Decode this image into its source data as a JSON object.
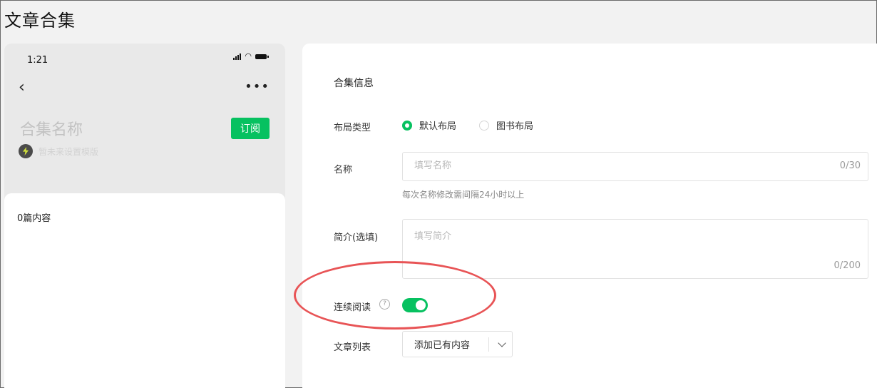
{
  "page": {
    "title": "文章合集"
  },
  "preview": {
    "status_time": "1:21",
    "status_icons": [
      "signal-icon",
      "wifi-icon",
      "battery-icon"
    ],
    "back_icon": "back-chevron-icon",
    "more_icon": "more-dots-icon",
    "more_label": "•••",
    "back_label": "‹",
    "collection_name": "合集名称",
    "subscribe_label": "订阅",
    "account_name": "暂未来设置模版",
    "content_count": "0篇内容"
  },
  "form": {
    "section_title": "合集信息",
    "layout": {
      "label": "布局类型",
      "options": [
        {
          "label": "默认布局",
          "selected": true
        },
        {
          "label": "图书布局",
          "selected": false
        }
      ]
    },
    "name": {
      "label": "名称",
      "placeholder": "填写名称",
      "value": "",
      "counter": "0/30",
      "hint": "每次名称修改需间隔24小时以上"
    },
    "intro": {
      "label": "简介(选填)",
      "placeholder": "填写简介",
      "value": "",
      "counter": "0/200"
    },
    "continuous_reading": {
      "label": "连续阅读",
      "help_label": "?",
      "enabled": true
    },
    "article_list": {
      "label": "文章列表",
      "dropdown_label": "添加已有内容"
    }
  },
  "colors": {
    "accent": "#07c160",
    "annotation": "#e85456"
  }
}
